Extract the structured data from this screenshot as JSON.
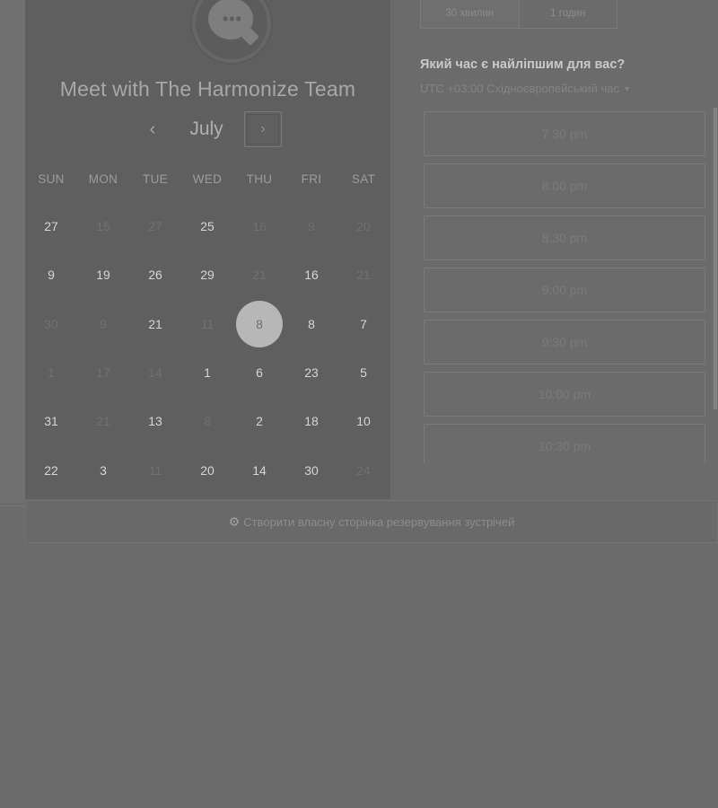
{
  "calendar": {
    "title": "Meet with The Harmonize Team",
    "month": "July",
    "prev_icon": "‹",
    "next_icon": "›",
    "weekdays": [
      "SUN",
      "MON",
      "TUE",
      "WED",
      "THU",
      "FRI",
      "SAT"
    ],
    "weeks": [
      [
        {
          "d": "27",
          "m": false
        },
        {
          "d": "15",
          "m": true
        },
        {
          "d": "27",
          "m": true
        },
        {
          "d": "25",
          "m": false
        },
        {
          "d": "16",
          "m": true
        },
        {
          "d": "9",
          "m": true
        },
        {
          "d": "20",
          "m": true
        }
      ],
      [
        {
          "d": "9",
          "m": false
        },
        {
          "d": "19",
          "m": false
        },
        {
          "d": "26",
          "m": false
        },
        {
          "d": "29",
          "m": false
        },
        {
          "d": "21",
          "m": true
        },
        {
          "d": "16",
          "m": false
        },
        {
          "d": "21",
          "m": true
        }
      ],
      [
        {
          "d": "30",
          "m": true
        },
        {
          "d": "9",
          "m": true
        },
        {
          "d": "21",
          "m": false
        },
        {
          "d": "11",
          "m": true
        },
        {
          "d": "8",
          "m": false,
          "selected": true
        },
        {
          "d": "8",
          "m": false
        },
        {
          "d": "7",
          "m": false
        }
      ],
      [
        {
          "d": "1",
          "m": true
        },
        {
          "d": "17",
          "m": true
        },
        {
          "d": "14",
          "m": true
        },
        {
          "d": "1",
          "m": false
        },
        {
          "d": "6",
          "m": false
        },
        {
          "d": "23",
          "m": false
        },
        {
          "d": "5",
          "m": false
        }
      ],
      [
        {
          "d": "31",
          "m": false
        },
        {
          "d": "21",
          "m": true
        },
        {
          "d": "13",
          "m": false
        },
        {
          "d": "8",
          "m": true
        },
        {
          "d": "2",
          "m": false
        },
        {
          "d": "18",
          "m": false
        },
        {
          "d": "10",
          "m": false
        }
      ],
      [
        {
          "d": "22",
          "m": false
        },
        {
          "d": "3",
          "m": false
        },
        {
          "d": "11",
          "m": true
        },
        {
          "d": "20",
          "m": false
        },
        {
          "d": "14",
          "m": false
        },
        {
          "d": "30",
          "m": false
        },
        {
          "d": "24",
          "m": true
        }
      ]
    ]
  },
  "duration": {
    "options": [
      "30 хвилин",
      "1 годин"
    ],
    "selected_index": 0
  },
  "time_picker": {
    "question": "Який час є найліпшим для вас?",
    "timezone": "UTC +03:00 Східноєвропейський час",
    "slots": [
      "7:30 pm",
      "8:00 pm",
      "8:30 pm",
      "9:00 pm",
      "9:30 pm",
      "10:00 pm",
      "10:30 pm"
    ]
  },
  "footer": {
    "text": "Створити власну сторінка резервування зустрічей",
    "icon": "hubspot-sprocket-icon"
  }
}
